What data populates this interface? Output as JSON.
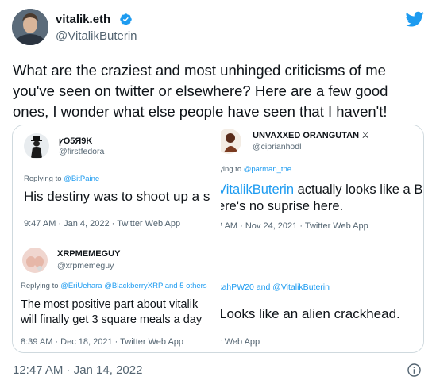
{
  "author": {
    "display_name": "vitalik.eth",
    "handle": "@VitalikButerin"
  },
  "tweet": {
    "text": "What are the craziest and most unhinged criticisms of me you've seen on twitter or elsewhere? Here are a few good ones, I wonder what else people have seen that I haven't!",
    "timestamp": "12:47 AM · Jan 14, 2022"
  },
  "media": {
    "shot_a": {
      "name": "ꝩO5Я9K",
      "handle": "@firstfedora",
      "reply_prefix": "Replying to",
      "reply_to": "@BitPaine",
      "body": "His destiny was to shoot up a s",
      "meta": "9:47 AM · Jan 4, 2022 · Twitter Web App"
    },
    "shot_b": {
      "name": "UNVAXXED ORANGUTAN ⚔",
      "handle": "@ciprianhodl",
      "reply_prefix": "lying to",
      "reply_to": "@parman_the",
      "body_link": "VitalikButerin",
      "body_line1_rest": " actually looks like a Bo",
      "body_line2": "ere's no suprise here.",
      "meta": "2 AM · Nov 24, 2021 · Twitter Web App"
    },
    "shot_c": {
      "name": "XRPMEMEGUY",
      "handle": "@xrpmemeguy",
      "reply_prefix": "Replying to",
      "reply_to": "@EriUehara @BlackberryXRP and 5 others",
      "body_line1": "The most positive part about vitalik",
      "body_line2": "will finally get 3 square meals a day",
      "meta": "8:39 AM · Dec 18, 2021 · Twitter Web App"
    },
    "shot_d": {
      "reply_partial": "icahPW20 and @VitalikButerin",
      "body": "Looks like an alien crackhead.",
      "meta": "r Web App"
    }
  },
  "colors": {
    "accent": "#1d9bf0",
    "secondary_text": "#536471",
    "primary_text": "#0f1419",
    "border": "#cfd9de"
  },
  "icons": [
    "verified-badge-icon",
    "twitter-bird-icon",
    "info-icon"
  ]
}
